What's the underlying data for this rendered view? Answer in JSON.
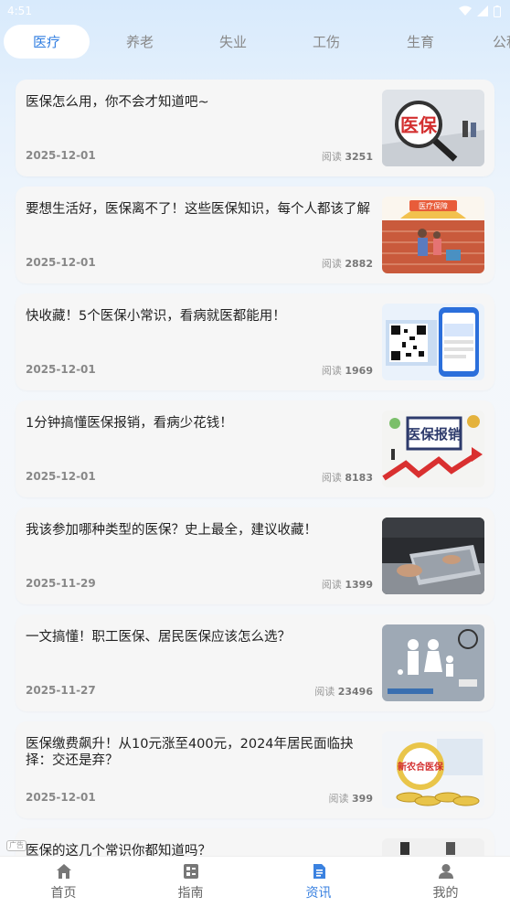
{
  "status_bar": {
    "time": "4:51"
  },
  "tabs": [
    {
      "label": "医疗",
      "active": true
    },
    {
      "label": "养老",
      "active": false
    },
    {
      "label": "失业",
      "active": false
    },
    {
      "label": "工伤",
      "active": false
    },
    {
      "label": "生育",
      "active": false
    },
    {
      "label": "公积",
      "active": false
    }
  ],
  "articles": [
    {
      "title": "医保怎么用，你不会才知道吧~",
      "date": "2025-12-01",
      "views_label": "阅读",
      "views": "3251",
      "thumb": "magnifier-insurance"
    },
    {
      "title": "要想生活好，医保离不了！这些医保知识，每个人都该了解",
      "date": "2025-12-01",
      "views_label": "阅读",
      "views": "2882",
      "thumb": "umbrella-family"
    },
    {
      "title": "快收藏！5个医保小常识，看病就医都能用！",
      "date": "2025-12-01",
      "views_label": "阅读",
      "views": "1969",
      "thumb": "qr-phone"
    },
    {
      "title": "1分钟搞懂医保报销，看病少花钱！",
      "date": "2025-12-01",
      "views_label": "阅读",
      "views": "8183",
      "thumb": "reimbursement-arrow"
    },
    {
      "title": "我该参加哪种类型的医保？史上最全，建议收藏！",
      "date": "2025-11-29",
      "views_label": "阅读",
      "views": "1399",
      "thumb": "laptop-hands"
    },
    {
      "title": "一文搞懂！职工医保、居民医保应该怎么选？",
      "date": "2025-11-27",
      "views_label": "阅读",
      "views": "23496",
      "thumb": "paper-family"
    },
    {
      "title": "医保缴费飙升！从10元涨至400元，2024年居民面临抉择：交还是弃？",
      "date": "2025-12-01",
      "views_label": "阅读",
      "views": "399",
      "thumb": "coins-seal"
    },
    {
      "title": "医保的这几个常识你都知道吗？",
      "date": "",
      "views_label": "",
      "views": "",
      "thumb": "partial"
    }
  ],
  "ad_tag": "广告",
  "bottom_nav": [
    {
      "label": "首页",
      "icon": "home-icon",
      "active": false
    },
    {
      "label": "指南",
      "icon": "guide-icon",
      "active": false
    },
    {
      "label": "资讯",
      "icon": "news-icon",
      "active": true
    },
    {
      "label": "我的",
      "icon": "profile-icon",
      "active": false
    }
  ],
  "colors": {
    "accent": "#3b82e0",
    "tab_active": "#2f7de1"
  }
}
